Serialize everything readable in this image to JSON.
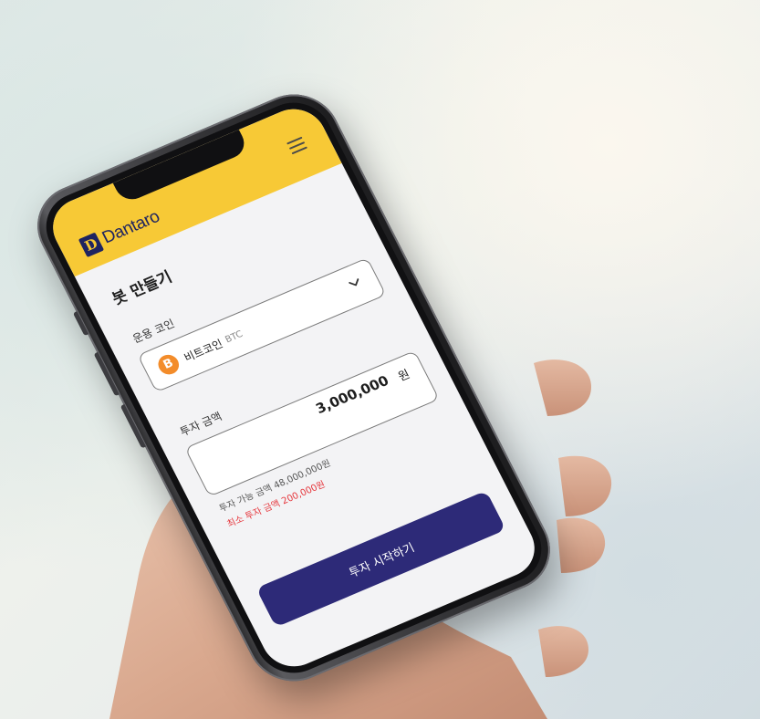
{
  "app": {
    "brand_mark": "D",
    "brand_name": "Dantaro"
  },
  "page": {
    "title": "봇 만들기"
  },
  "coin_field": {
    "label": "운용 코인",
    "selected_name": "비트코인",
    "selected_symbol": "BTC",
    "coin_icon_glyph": "B"
  },
  "amount_field": {
    "label": "투자 금액",
    "value": "3,000,000",
    "unit": "원",
    "available_text": "투자 가능 금액 48,000,000원",
    "minimum_text": "최소 투자 금액 200,000원"
  },
  "actions": {
    "start_label": "투자 시작하기"
  },
  "colors": {
    "header": "#f7c936",
    "brand": "#1f2460",
    "button": "#2d2a78",
    "bitcoin": "#f38c2a",
    "warning": "#e6353b"
  },
  "icons": {
    "menu": "hamburger-menu-icon",
    "dropdown": "chevron-down-icon",
    "coin": "bitcoin-icon"
  }
}
